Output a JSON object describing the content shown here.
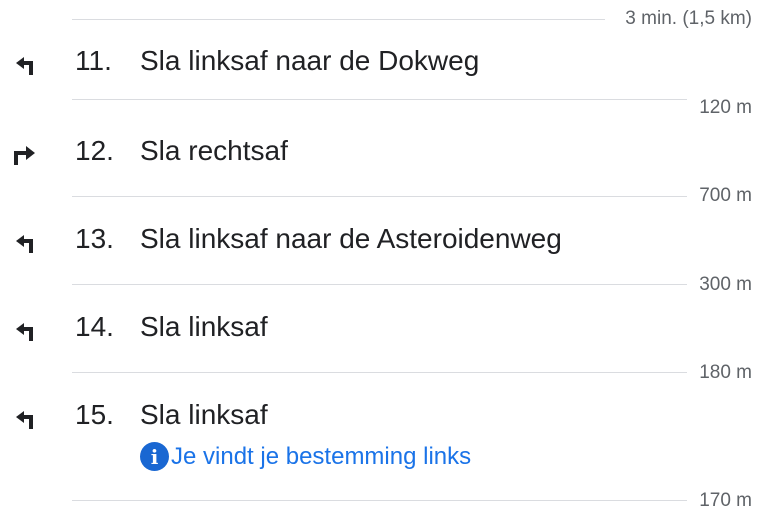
{
  "header": {
    "summary": "3 min. (1,5 km)"
  },
  "steps": [
    {
      "number": "11.",
      "instruction": "Sla linksaf naar de Dokweg",
      "direction": "turn-left-icon",
      "distance": "120 m"
    },
    {
      "number": "12.",
      "instruction": "Sla rechtsaf",
      "direction": "turn-right-icon",
      "distance": "700 m"
    },
    {
      "number": "13.",
      "instruction": "Sla linksaf naar de Asteroidenweg",
      "direction": "turn-left-icon",
      "distance": "300 m"
    },
    {
      "number": "14.",
      "instruction": "Sla linksaf",
      "direction": "turn-left-icon",
      "distance": "180 m"
    },
    {
      "number": "15.",
      "instruction": "Sla linksaf",
      "direction": "turn-left-icon",
      "note": "Je vindt je bestemming links",
      "note_icon": "info-icon",
      "distance": "170 m"
    }
  ],
  "colors": {
    "text": "#202124",
    "secondary": "#5f6368",
    "link": "#1a73e8",
    "info_badge": "#1967d2",
    "divider": "#dadce0"
  }
}
